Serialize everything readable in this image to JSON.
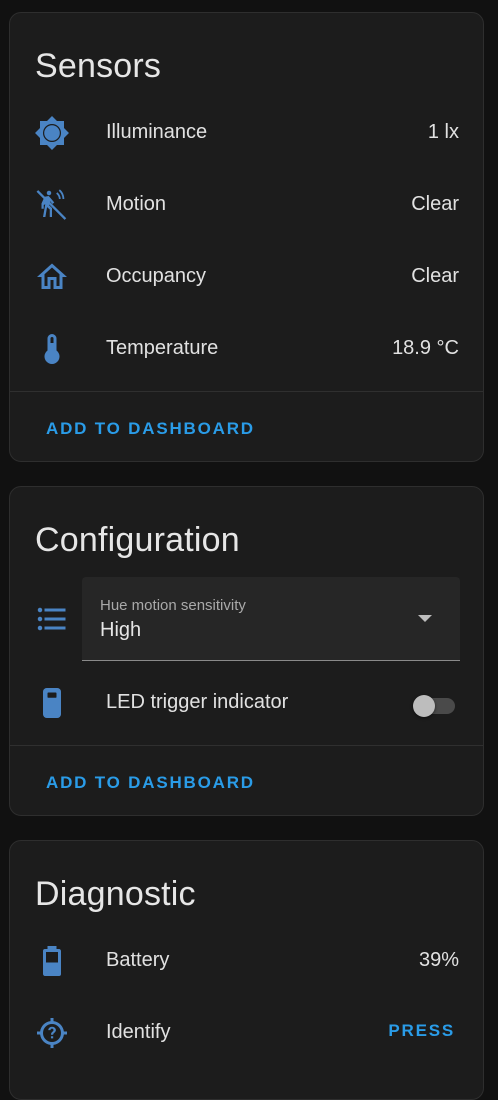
{
  "colors": {
    "accent": "#2a9ce8",
    "icon": "#4a84c4",
    "card_bg": "#1c1c1c",
    "page_bg": "#111111"
  },
  "sensors": {
    "title": "Sensors",
    "items": [
      {
        "icon": "brightness-icon",
        "label": "Illuminance",
        "value": "1 lx"
      },
      {
        "icon": "motion-sensor-off-icon",
        "label": "Motion",
        "value": "Clear"
      },
      {
        "icon": "home-outline-icon",
        "label": "Occupancy",
        "value": "Clear"
      },
      {
        "icon": "thermometer-icon",
        "label": "Temperature",
        "value": "18.9 °C"
      }
    ],
    "action_label": "ADD TO DASHBOARD"
  },
  "configuration": {
    "title": "Configuration",
    "select": {
      "icon": "list-icon",
      "label": "Hue motion sensitivity",
      "value": "High"
    },
    "toggle": {
      "icon": "led-indicator-icon",
      "label": "LED trigger indicator",
      "state": "off"
    },
    "action_label": "ADD TO DASHBOARD"
  },
  "diagnostic": {
    "title": "Diagnostic",
    "items": [
      {
        "icon": "battery-icon",
        "label": "Battery",
        "value": "39%"
      },
      {
        "icon": "identify-icon",
        "label": "Identify",
        "button_label": "PRESS"
      }
    ]
  }
}
